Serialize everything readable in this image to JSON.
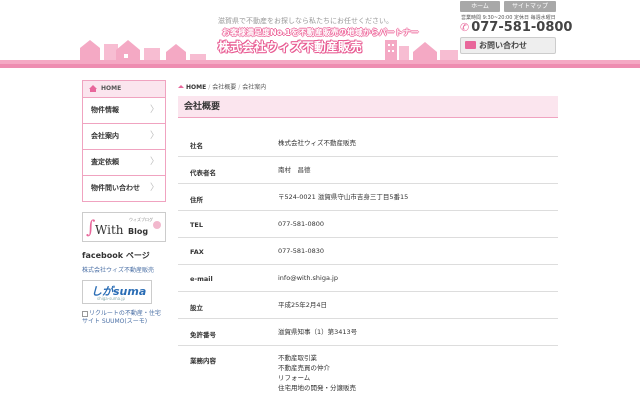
{
  "header": {
    "tagline": "滋賀県で不動産をお探しなら私たちにお任せください。",
    "catchcopy": "お客様満足度No.1を不動産販売の地域からパートナー",
    "company_logo_text": "株式会社ウィズ不動産販売",
    "top_links": [
      "ホーム",
      "サイトマップ"
    ],
    "hours": "営業時間 9:30~20:00 定休日 毎週水曜日",
    "phone": "077-581-0800",
    "contact_button": "お問い合わせ"
  },
  "sidebar": {
    "home_label": "HOME",
    "nav_items": [
      {
        "label": "物件情報"
      },
      {
        "label": "会社案内"
      },
      {
        "label": "査定依頼"
      },
      {
        "label": "物件問い合わせ"
      }
    ],
    "blog_banner": {
      "brand": "With",
      "label": "Blog",
      "sub": "ウィズブログ"
    },
    "facebook_title": "facebook ページ",
    "facebook_link": "株式会社ウィズ不動産販売",
    "shizuma_logo": "しがsuma",
    "shizuma_sub": "shiga-suma.jp",
    "suumo_alt": "リクルートの不動産・住宅サイト SUUMO(スーモ)"
  },
  "breadcrumb": {
    "home": "HOME",
    "items": [
      "会社概要",
      "会社案内"
    ]
  },
  "page_title": "会社概要",
  "company_info": [
    {
      "label": "社名",
      "value": [
        "株式会社ウィズ不動産販売"
      ]
    },
    {
      "label": "代表者名",
      "value": [
        "南村　昌德"
      ]
    },
    {
      "label": "住所",
      "value": [
        "〒524-0021 滋賀県守山市吉身三丁目5番15"
      ]
    },
    {
      "label": "TEL",
      "value": [
        "077-581-0800"
      ]
    },
    {
      "label": "FAX",
      "value": [
        "077-581-0830"
      ]
    },
    {
      "label": "e-mail",
      "value": [
        "info@with.shiga.jp"
      ]
    },
    {
      "label": "設立",
      "value": [
        "平成25年2月4日"
      ]
    },
    {
      "label": "免許番号",
      "value": [
        "滋賀県知事（1）第3413号"
      ]
    },
    {
      "label": "業務内容",
      "value": [
        "不動産取引業",
        "不動産売買の仲介",
        "リフォーム",
        "住宅用地の開発・分譲販売"
      ]
    }
  ],
  "colors": {
    "accent_pink": "#e8679b",
    "light_pink": "#fbe5ee",
    "border_pink": "#f0a3c0"
  }
}
